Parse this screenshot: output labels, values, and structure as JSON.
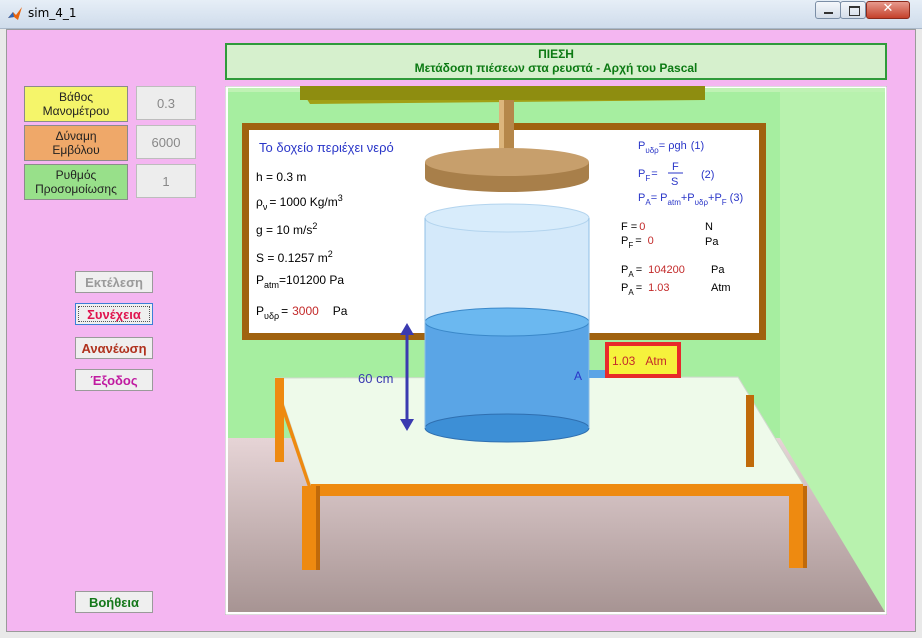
{
  "window": {
    "title": "sim_4_1",
    "close_glyph": "✕"
  },
  "header": {
    "line1": "ΠΙΕΣΗ",
    "line2": "Μετάδοση πιέσεων στα ρευστά - Αρχή του Pascal"
  },
  "params": [
    {
      "label1": "Βάθος",
      "label2": "Μανομέτρου",
      "value": "0.3",
      "color": "#f5f56a"
    },
    {
      "label1": "Δύναμη",
      "label2": "Εμβόλου",
      "value": "6000",
      "color": "#efa869"
    },
    {
      "label1": "Ρυθμός",
      "label2": "Προσομοίωσης",
      "value": "1",
      "color": "#98e08a"
    }
  ],
  "buttons": {
    "run": "Εκτέλεση",
    "continue": "Συνέχεια",
    "refresh": "Ανανέωση",
    "exit": "Έξοδος",
    "help": "Βοήθεια"
  },
  "board": {
    "heading": "Το δοχείο περιέχει νερό",
    "h_label": "h =",
    "h_value": "0.3",
    "h_unit": "m",
    "rho_label": "ρ",
    "rho_sub": "ν",
    "rho_value": "= 1000 Kg/m",
    "rho_sup": "3",
    "g_text": "g = 10 m/s",
    "g_sup": "2",
    "s_text": "S = 0.1257 m",
    "s_sup": "2",
    "patm_label": "P",
    "patm_sub": "atm",
    "patm_value": "=101200 Pa",
    "phyd_label": "P",
    "phyd_sub": "υδρ",
    "phyd_eq": "=",
    "phyd_value": "3000",
    "phyd_unit": "Pa",
    "eq1_lhs": "P",
    "eq1_sub": "υδρ",
    "eq1_rhs": "= ρgh",
    "eq1_num": "(1)",
    "eq2_lhs": "P",
    "eq2_sub": "F",
    "eq2_eq": "=",
    "eq2_num_top": "F",
    "eq2_den": "S",
    "eq2_num": "(2)",
    "eq3_lhs": "P",
    "eq3_sub": "A",
    "eq3_eq": "= P",
    "eq3_sub1": "atm",
    "eq3_plus1": "+P",
    "eq3_sub2": "υδρ",
    "eq3_plus2": "+P",
    "eq3_sub3": "F",
    "eq3_num": "(3)",
    "f_label": "F =",
    "f_value": "0",
    "f_unit": "N",
    "pf_label": "P",
    "pf_sub": "F",
    "pf_eq": "=",
    "pf_value": "0",
    "pf_unit": "Pa",
    "pa1_label": "P",
    "pa1_sub": "A",
    "pa1_eq": "=",
    "pa1_value": "104200",
    "pa1_unit": "Pa",
    "pa2_label": "P",
    "pa2_sub": "A",
    "pa2_eq": "=",
    "pa2_value": "1.03",
    "pa2_unit": "Atm"
  },
  "gauge": {
    "value": "1.03",
    "unit": "Atm",
    "point_label": "A"
  },
  "depth_label": "60 cm",
  "colors": {
    "wall": "#a6eea0",
    "board_frame": "#a0620f",
    "water": "#5aa5e6",
    "table_edge": "#ee8a10",
    "blue_text": "#2a36c8",
    "red_text": "#c32a2a"
  }
}
